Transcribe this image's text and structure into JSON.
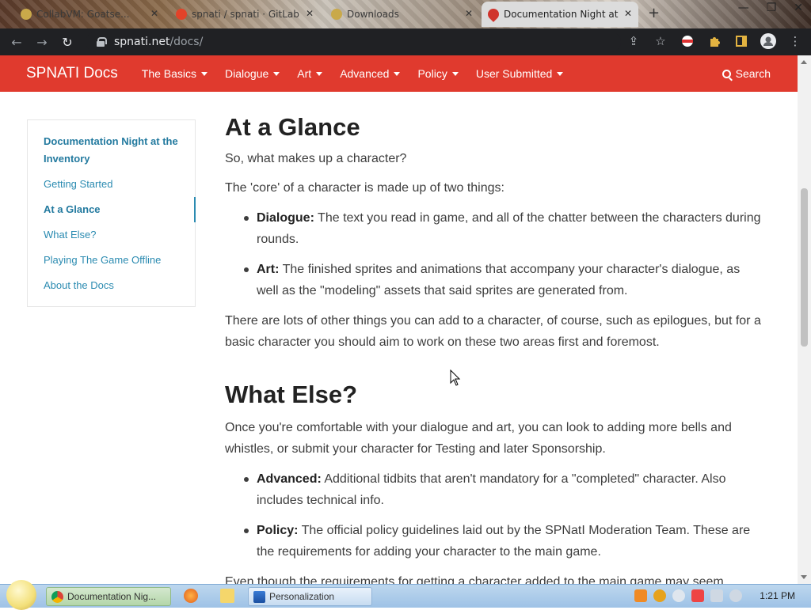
{
  "browser": {
    "tabs": [
      {
        "title": "CollabVM: Goatse...",
        "favicon_color": "#c9a94a"
      },
      {
        "title": "spnati / spnati · GitLab",
        "favicon_color": "#e24329"
      },
      {
        "title": "Downloads",
        "favicon_color": "#c9a94a"
      },
      {
        "title": "Documentation Night at",
        "favicon_color": "#d0342c",
        "active": true
      }
    ],
    "new_tab": "+",
    "window_buttons": [
      "—",
      "❐",
      "✕"
    ],
    "url_host": "spnati.net",
    "url_path": "/docs/"
  },
  "site": {
    "brand": "SPNATI Docs",
    "nav": [
      "The Basics",
      "Dialogue",
      "Art",
      "Advanced",
      "Policy",
      "User Submitted"
    ],
    "search_label": "Search",
    "accent": "#e03a2e"
  },
  "sidebar": {
    "items": [
      {
        "label": "Documentation Night at the Inventory",
        "bold": true
      },
      {
        "label": "Getting Started",
        "bold": false
      },
      {
        "label": "At a Glance",
        "bold": true,
        "active": true
      },
      {
        "label": "What Else?",
        "bold": false
      },
      {
        "label": "Playing The Game Offline",
        "bold": false
      },
      {
        "label": "About the Docs",
        "bold": false
      }
    ]
  },
  "content": {
    "glance_heading": "At a Glance",
    "glance_p1": "So, what makes up a character?",
    "glance_p2": "The 'core' of a character is made up of two things:",
    "dialogue_term": "Dialogue:",
    "dialogue_desc": " The text you read in game, and all of the chatter between the characters during rounds.",
    "art_term": "Art:",
    "art_desc": " The finished sprites and animations that accompany your character's dialogue, as well as the \"modeling\" assets that said sprites are generated from.",
    "glance_p3": "There are lots of other things you can add to a character, of course, such as epilogues, but for a basic character you should aim to work on these two areas first and foremost.",
    "else_heading": "What Else?",
    "else_p1": "Once you're comfortable with your dialogue and art, you can look to adding more bells and whistles, or submit your character for Testing and later Sponsorship.",
    "advanced_term": "Advanced:",
    "advanced_desc": " Additional tidbits that aren't mandatory for a \"completed\" character. Also includes technical info.",
    "policy_term": "Policy:",
    "policy_desc": " The official policy guidelines laid out by the SPNatI Moderation Team. These are the requirements for adding your character to the main game.",
    "else_p2": "Even though the requirements for getting a character added to the main game may seem"
  },
  "taskbar": {
    "tasks": [
      {
        "label": "Documentation Nig...",
        "active": true
      },
      {
        "label": "Personalization",
        "active": false
      }
    ],
    "clock": "1:21 PM"
  }
}
